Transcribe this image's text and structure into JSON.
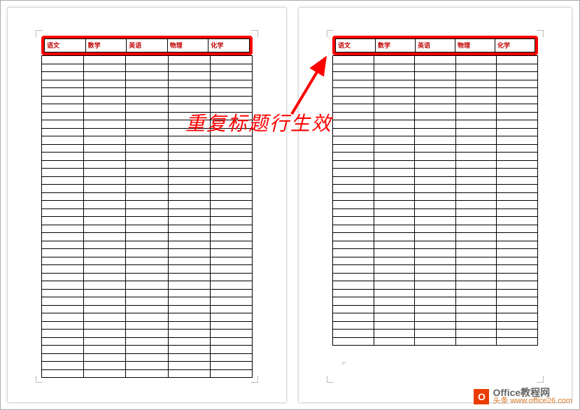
{
  "table": {
    "headers": [
      "语文",
      "数学",
      "英语",
      "物理",
      "化学"
    ],
    "page1_body_rows": 40,
    "page2_body_rows": 36
  },
  "annotation": {
    "text": "重复标题行生效"
  },
  "watermark": {
    "icon_letter": "O",
    "title": "Office教程网",
    "url_prefix": "头条",
    "url": "www.office26.com"
  }
}
